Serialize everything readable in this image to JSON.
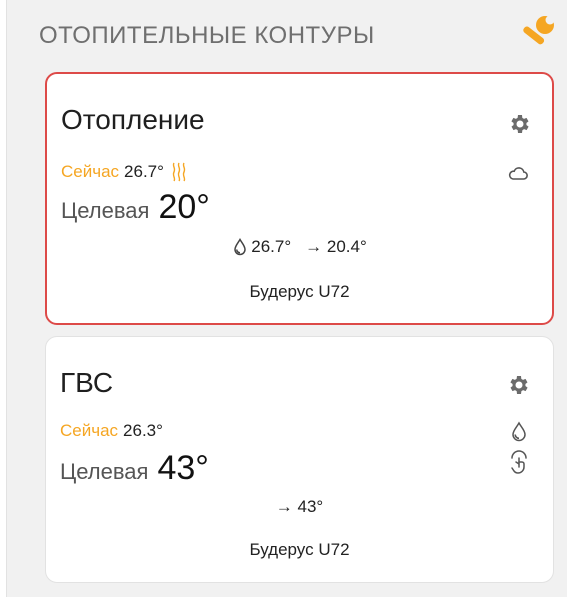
{
  "section": {
    "title": "ОТОПИТЕЛЬНЫЕ КОНТУРЫ",
    "settings_icon": "wrench-icon",
    "accent_color": "#f5a623"
  },
  "cards": [
    {
      "title": "Отопление",
      "now_label": "Сейчас",
      "now_value": "26.7°",
      "status_icon": "heating-waves-icon",
      "mode_icon": "cloud-icon",
      "target_label": "Целевая",
      "target_value": "20°",
      "drop_value": "26.7°",
      "arrow_value": "→ 20.4°",
      "boiler": "Будерус U72",
      "border_color": "#dd4a48"
    },
    {
      "title": "ГВС",
      "now_label": "Сейчас",
      "now_value": "26.3°",
      "mode_icon": "drop-icon",
      "secondary_icon": "hand-touch-icon",
      "target_label": "Целевая",
      "target_value": "43°",
      "arrow_value": "→ 43°",
      "boiler": "Будерус U72"
    }
  ]
}
